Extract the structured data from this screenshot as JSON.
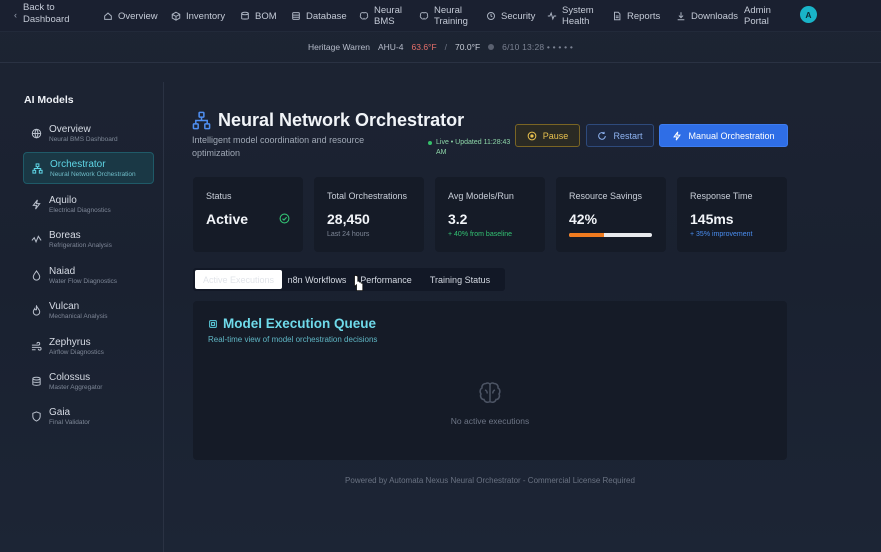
{
  "nav": {
    "back_label": "Back to Dashboard",
    "items": [
      {
        "label": "Overview",
        "icon": "home-icon"
      },
      {
        "label": "Inventory",
        "icon": "box-icon"
      },
      {
        "label": "BOM",
        "icon": "layers-icon"
      },
      {
        "label": "Database",
        "icon": "database-icon"
      },
      {
        "label": "Neural BMS",
        "icon": "brain-icon"
      },
      {
        "label": "Neural Training",
        "icon": "brain-icon"
      },
      {
        "label": "Security",
        "icon": "shield-icon"
      },
      {
        "label": "System Health",
        "icon": "activity-icon"
      },
      {
        "label": "Reports",
        "icon": "file-icon"
      },
      {
        "label": "Downloads",
        "icon": "download-icon"
      },
      {
        "label": "Admin Portal",
        "icon": ""
      }
    ],
    "avatar_initial": "A"
  },
  "status_bar": {
    "site": "Heritage Warren",
    "unit": "AHU-4",
    "temp_a": "63.6°F",
    "separator": "/",
    "temp_b": "70.0°F",
    "time": "6/10 13:28 • • • • •"
  },
  "sidebar": {
    "title": "AI Models",
    "items": [
      {
        "label": "Overview",
        "sub": "Neural BMS Dashboard",
        "icon": "globe-icon",
        "active": false
      },
      {
        "label": "Orchestrator",
        "sub": "Neural Network Orchestration",
        "icon": "network-icon",
        "active": true
      },
      {
        "label": "Aquilo",
        "sub": "Electrical Diagnostics",
        "icon": "bolt-icon",
        "active": false
      },
      {
        "label": "Boreas",
        "sub": "Refrigeration Analysis",
        "icon": "pulse-icon",
        "active": false
      },
      {
        "label": "Naiad",
        "sub": "Water Flow Diagnostics",
        "icon": "droplet-icon",
        "active": false
      },
      {
        "label": "Vulcan",
        "sub": "Mechanical Analysis",
        "icon": "flame-icon",
        "active": false
      },
      {
        "label": "Zephyrus",
        "sub": "Airflow Diagnostics",
        "icon": "wind-icon",
        "active": false
      },
      {
        "label": "Colossus",
        "sub": "Master Aggregator",
        "icon": "database-icon",
        "active": false
      },
      {
        "label": "Gaia",
        "sub": "Final Validator",
        "icon": "shield-icon",
        "active": false
      }
    ]
  },
  "header": {
    "title": "Neural Network Orchestrator",
    "subtitle": "Intelligent model coordination and resource optimization",
    "live_text": "Live • Updated 11:28:43 AM"
  },
  "buttons": {
    "pause": "Pause",
    "restart": "Restart",
    "manual": "Manual Orchestration"
  },
  "stats": [
    {
      "label": "Status",
      "value": "Active",
      "note": ""
    },
    {
      "label": "Total Orchestrations",
      "value": "28,450",
      "note": "Last 24 hours"
    },
    {
      "label": "Avg Models/Run",
      "value": "3.2",
      "note": "+ 40% from baseline"
    },
    {
      "label": "Resource Savings",
      "value": "42%",
      "note": "",
      "progress": 0.42
    },
    {
      "label": "Response Time",
      "value": "145ms",
      "note": "+ 35% improvement"
    }
  ],
  "tabs": [
    {
      "label": "Active Executions",
      "active": true
    },
    {
      "label": "n8n Workflows",
      "active": false
    },
    {
      "label": "Performance",
      "active": false
    },
    {
      "label": "Training Status",
      "active": false
    }
  ],
  "queue": {
    "title": "Model Execution Queue",
    "subtitle": "Real-time view of model orchestration decisions",
    "empty_text": "No active executions"
  },
  "footer": "Powered by Automata Nexus Neural Orchestrator - Commercial License Required",
  "colors": {
    "accent_cyan": "#5fd6e6",
    "primary_blue": "#2f6ee6",
    "pause_gold": "#e7c04e",
    "progress_orange": "#f07b1f",
    "green": "#33c273"
  }
}
